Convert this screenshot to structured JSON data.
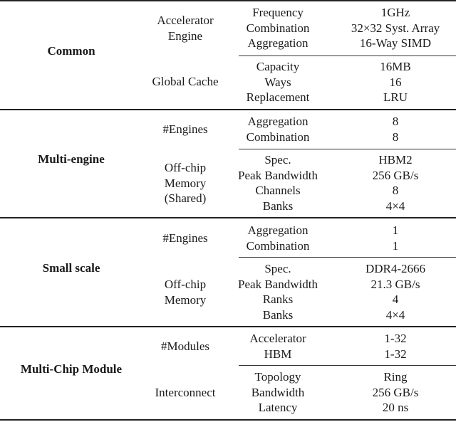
{
  "table": {
    "sections": [
      {
        "label": "Common",
        "groups": [
          {
            "label": [
              "Accelerator",
              "Engine"
            ],
            "rows": [
              {
                "param": "Frequency",
                "value": "1GHz"
              },
              {
                "param": "Combination",
                "value": "32×32 Syst. Array"
              },
              {
                "param": "Aggregation",
                "value": "16-Way SIMD"
              }
            ]
          },
          {
            "label": [
              "Global Cache"
            ],
            "rows": [
              {
                "param": "Capacity",
                "value": "16MB"
              },
              {
                "param": "Ways",
                "value": "16"
              },
              {
                "param": "Replacement",
                "value": "LRU"
              }
            ]
          }
        ]
      },
      {
        "label": "Multi-engine",
        "groups": [
          {
            "label": [
              "#Engines"
            ],
            "rows": [
              {
                "param": "Aggregation",
                "value": "8"
              },
              {
                "param": "Combination",
                "value": "8"
              }
            ]
          },
          {
            "label": [
              "Off-chip",
              "Memory",
              "(Shared)"
            ],
            "rows": [
              {
                "param": "Spec.",
                "value": "HBM2"
              },
              {
                "param": "Peak Bandwidth",
                "value": "256 GB/s"
              },
              {
                "param": "Channels",
                "value": "8"
              },
              {
                "param": "Banks",
                "value": "4×4"
              }
            ]
          }
        ]
      },
      {
        "label": "Small scale",
        "groups": [
          {
            "label": [
              "#Engines"
            ],
            "rows": [
              {
                "param": "Aggregation",
                "value": "1"
              },
              {
                "param": "Combination",
                "value": "1"
              }
            ]
          },
          {
            "label": [
              "Off-chip",
              "Memory"
            ],
            "rows": [
              {
                "param": "Spec.",
                "value": "DDR4-2666"
              },
              {
                "param": "Peak Bandwidth",
                "value": "21.3 GB/s"
              },
              {
                "param": "Ranks",
                "value": "4"
              },
              {
                "param": "Banks",
                "value": "4×4"
              }
            ]
          }
        ]
      },
      {
        "label": "Multi-Chip Module",
        "groups": [
          {
            "label": [
              "#Modules"
            ],
            "rows": [
              {
                "param": "Accelerator",
                "value": "1-32"
              },
              {
                "param": "HBM",
                "value": "1-32"
              }
            ]
          },
          {
            "label": [
              "Interconnect"
            ],
            "rows": [
              {
                "param": "Topology",
                "value": "Ring"
              },
              {
                "param": "Bandwidth",
                "value": "256 GB/s"
              },
              {
                "param": "Latency",
                "value": "20 ns"
              }
            ]
          }
        ]
      }
    ]
  }
}
